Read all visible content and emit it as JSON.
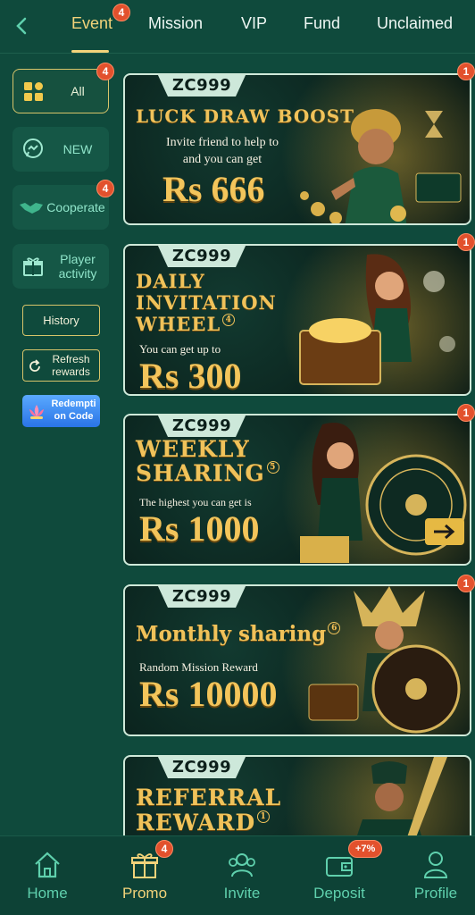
{
  "tabs": [
    {
      "label": "Event",
      "badge": "4"
    },
    {
      "label": "Mission"
    },
    {
      "label": "VIP"
    },
    {
      "label": "Fund"
    },
    {
      "label": "Unclaimed"
    }
  ],
  "sidebar": {
    "items": [
      {
        "label": "All",
        "badge": "4",
        "icon": "grid-icon"
      },
      {
        "label": "NEW",
        "icon": "chat-bubble-icon"
      },
      {
        "label": "Cooperate",
        "badge": "4",
        "icon": "handshake-icon"
      },
      {
        "label": "Player activity",
        "icon": "gift-box-icon"
      }
    ],
    "history_label": "History",
    "refresh_label": "Refresh rewards",
    "redeem_label": "Redempti on Code"
  },
  "banners": [
    {
      "logo": "ZC999",
      "title": "LUCK DRAW BOOST",
      "subtitle": "Invite friend to help to and you can get",
      "amount": "Rs 666",
      "badge": "1"
    },
    {
      "logo": "ZC999",
      "title": "DAILY INVITATION WHEEL",
      "num": "4",
      "subtitle": "You can get up to",
      "amount": "Rs 300",
      "badge": "1"
    },
    {
      "logo": "ZC999",
      "title": "WEEKLY SHARING",
      "num": "5",
      "subtitle": "The highest you can get is",
      "amount": "Rs 1000",
      "badge": "1"
    },
    {
      "logo": "ZC999",
      "title": "Monthly sharing",
      "num": "6",
      "subtitle": "Random Mission Reward",
      "amount": "Rs 10000",
      "badge": "1"
    },
    {
      "logo": "ZC999",
      "title": "REFERRAL REWARD",
      "num": "1"
    }
  ],
  "bottom_nav": [
    {
      "label": "Home",
      "icon": "home-icon"
    },
    {
      "label": "Promo",
      "icon": "gift-icon",
      "badge": "4"
    },
    {
      "label": "Invite",
      "icon": "invite-people-icon"
    },
    {
      "label": "Deposit",
      "icon": "wallet-icon",
      "badge": "+7%"
    },
    {
      "label": "Profile",
      "icon": "profile-icon"
    }
  ],
  "colors": {
    "background": "#0f4a3c",
    "accent": "#f2d37a",
    "nav_text": "#5fd0ad",
    "badge": "#e2512d"
  }
}
